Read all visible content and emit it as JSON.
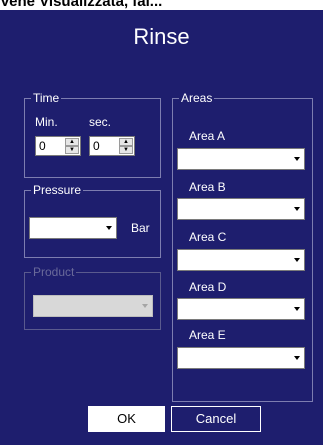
{
  "background_caption": "Vene Visualizzata, fai...",
  "dialog": {
    "title": "Rinse",
    "time": {
      "legend": "Time",
      "min_label": "Min.",
      "sec_label": "sec.",
      "min_value": "0",
      "sec_value": "0"
    },
    "pressure": {
      "legend": "Pressure",
      "value": "",
      "unit": "Bar"
    },
    "product": {
      "legend": "Product",
      "value": "",
      "enabled": false
    },
    "areas": {
      "legend": "Areas",
      "items": [
        {
          "label": "Area A",
          "value": ""
        },
        {
          "label": "Area B",
          "value": ""
        },
        {
          "label": "Area C",
          "value": ""
        },
        {
          "label": "Area D",
          "value": ""
        },
        {
          "label": "Area E",
          "value": ""
        }
      ]
    },
    "buttons": {
      "ok": "OK",
      "cancel": "Cancel"
    }
  },
  "colors": {
    "dialog_background": "#1e1e6e",
    "text": "#ffffff",
    "group_border": "#7d7db0"
  },
  "icons": {
    "spin_up": "triangle-up",
    "spin_down": "triangle-down",
    "dropdown": "triangle-down"
  }
}
